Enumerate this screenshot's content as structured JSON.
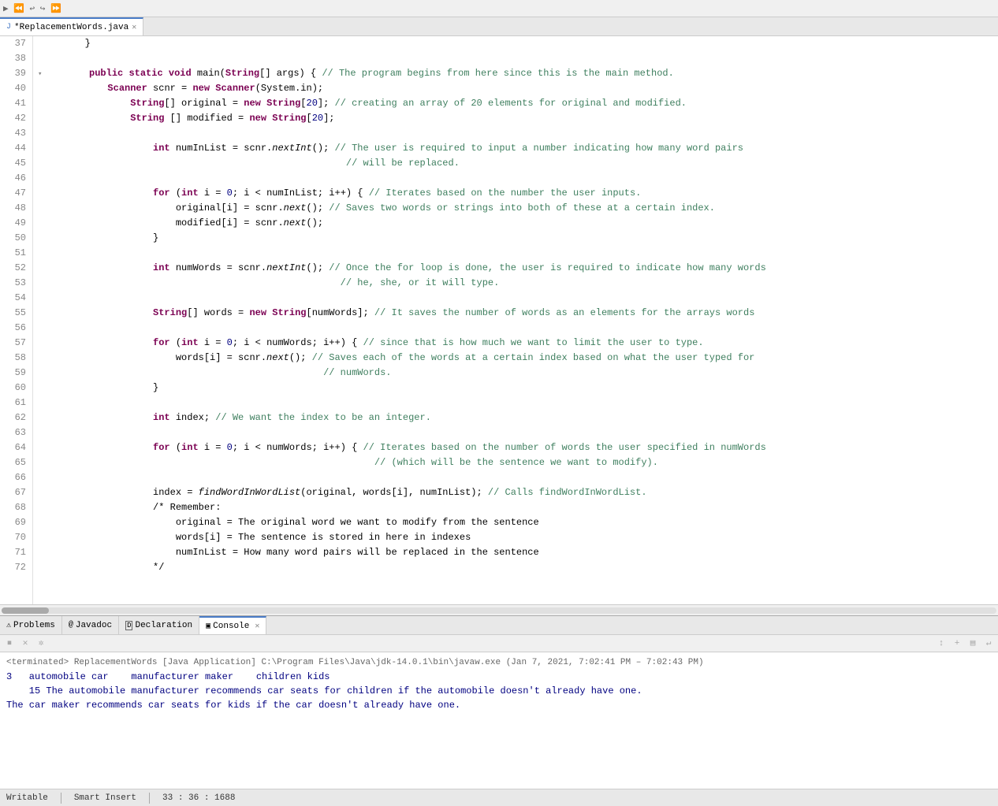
{
  "toolbar": {
    "icons": [
      "◀◀",
      "◀",
      "▶",
      "▶▶",
      "⏹",
      "⟳"
    ]
  },
  "tabs": [
    {
      "label": "*ReplacementWords.java",
      "icon": "J",
      "active": true,
      "close": "✕"
    }
  ],
  "lineNumbers": [
    37,
    38,
    39,
    40,
    41,
    42,
    43,
    44,
    45,
    46,
    47,
    48,
    49,
    50,
    51,
    52,
    53,
    54,
    55,
    56,
    57,
    58,
    59,
    60,
    61,
    62,
    63,
    64,
    65,
    66,
    67,
    68,
    69,
    70,
    71,
    72
  ],
  "codeLines": [
    {
      "ln": 37,
      "text": "        }"
    },
    {
      "ln": 38,
      "text": ""
    },
    {
      "ln": 39,
      "text": "        public static void main(String[] args) { // The program begins from here since this is the main method.",
      "fold": true
    },
    {
      "ln": 40,
      "text": "            Scanner scnr = new Scanner(System.in);"
    },
    {
      "ln": 41,
      "text": "                String[] original = new String[20]; // creating an array of 20 elements for original and modified."
    },
    {
      "ln": 42,
      "text": "                String [] modified = new String[20];"
    },
    {
      "ln": 43,
      "text": ""
    },
    {
      "ln": 44,
      "text": "                    int numInList = scnr.nextInt(); // The user is required to input a number indicating how many word pairs"
    },
    {
      "ln": 45,
      "text": "                                                      // will be replaced."
    },
    {
      "ln": 46,
      "text": ""
    },
    {
      "ln": 47,
      "text": "                    for (int i = 0; i < numInList; i++) { // Iterates based on the number the user inputs."
    },
    {
      "ln": 48,
      "text": "                        original[i] = scnr.next(); // Saves two words or strings into both of these at a certain index."
    },
    {
      "ln": 49,
      "text": "                        modified[i] = scnr.next();"
    },
    {
      "ln": 50,
      "text": "                    }"
    },
    {
      "ln": 51,
      "text": ""
    },
    {
      "ln": 52,
      "text": "                    int numWords = scnr.nextInt(); // Once the for loop is done, the user is required to indicate how many words"
    },
    {
      "ln": 53,
      "text": "                                                     // he, she, or it will type."
    },
    {
      "ln": 54,
      "text": ""
    },
    {
      "ln": 55,
      "text": "                    String[] words = new String[numWords]; // It saves the number of words as an elements for the arrays words"
    },
    {
      "ln": 56,
      "text": ""
    },
    {
      "ln": 57,
      "text": "                    for (int i = 0; i < numWords; i++) { // since that is how much we want to limit the user to type."
    },
    {
      "ln": 58,
      "text": "                        words[i] = scnr.next(); // Saves each of the words at a certain index based on what the user typed for"
    },
    {
      "ln": 59,
      "text": "                                                  // numWords."
    },
    {
      "ln": 60,
      "text": "                    }"
    },
    {
      "ln": 61,
      "text": ""
    },
    {
      "ln": 62,
      "text": "                    int index; // We want the index to be an integer."
    },
    {
      "ln": 63,
      "text": ""
    },
    {
      "ln": 64,
      "text": "                    for (int i = 0; i < numWords; i++) { // Iterates based on the number of words the user specified in numWords"
    },
    {
      "ln": 65,
      "text": "                                                           // (which will be the sentence we want to modify)."
    },
    {
      "ln": 66,
      "text": ""
    },
    {
      "ln": 67,
      "text": "                    index = findWordInWordList(original, words[i], numInList); // Calls findWordInWordList."
    },
    {
      "ln": 68,
      "text": "                    /* Remember:"
    },
    {
      "ln": 69,
      "text": "                        original = The original word we want to modify from the sentence"
    },
    {
      "ln": 70,
      "text": "                        words[i] = The sentence is stored in here in indexes"
    },
    {
      "ln": 71,
      "text": "                        numInList = How many word pairs will be replaced in the sentence"
    },
    {
      "ln": 72,
      "text": "                    */"
    }
  ],
  "bottomPanel": {
    "tabs": [
      {
        "label": "Problems",
        "icon": "⚠",
        "active": false
      },
      {
        "label": "Javadoc",
        "icon": "@",
        "active": false
      },
      {
        "label": "Declaration",
        "icon": "D",
        "active": false
      },
      {
        "label": "Console",
        "icon": "□",
        "active": true,
        "close": "✕"
      }
    ],
    "consoleHeader": "<terminated> ReplacementWords [Java Application] C:\\Program Files\\Java\\jdk-14.0.1\\bin\\javaw.exe (Jan 7, 2021, 7:02:41 PM – 7:02:43 PM)",
    "consoleLines": [
      "3   automobile car    manufacturer maker    children kids",
      "    15 The automobile manufacturer recommends car seats for children if the automobile doesn't already have one.",
      "The car maker recommends car seats for kids if the car doesn't already have one."
    ]
  },
  "statusBar": {
    "writable": "Writable",
    "insertMode": "Smart Insert",
    "position": "33 : 36 : 1688"
  }
}
